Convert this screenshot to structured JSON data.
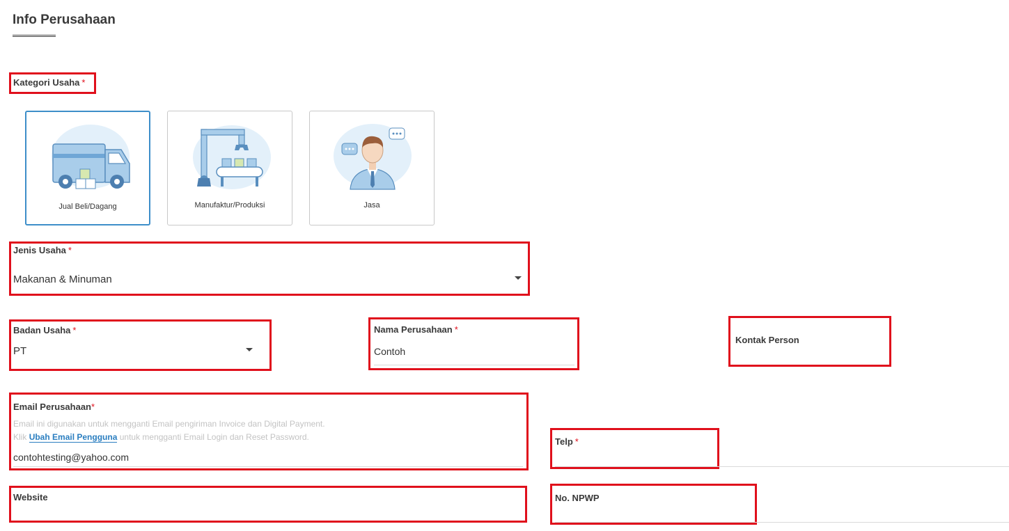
{
  "page": {
    "title": "Info Perusahaan"
  },
  "kategori": {
    "label": "Kategori Usaha",
    "required_mark": "*",
    "options": [
      {
        "label": "Jual Beli/Dagang",
        "icon": "truck-icon",
        "selected": true
      },
      {
        "label": "Manufaktur/Produksi",
        "icon": "robot-arm-conveyor-icon",
        "selected": false
      },
      {
        "label": "Jasa",
        "icon": "customer-service-person-icon",
        "selected": false
      }
    ]
  },
  "jenis_usaha": {
    "label": "Jenis Usaha",
    "required_mark": "*",
    "value": "Makanan & Minuman"
  },
  "badan_usaha": {
    "label": "Badan Usaha",
    "required_mark": "*",
    "value": "PT"
  },
  "nama_perusahaan": {
    "label": "Nama Perusahaan",
    "required_mark": "*",
    "value": "Contoh"
  },
  "kontak_person": {
    "label": "Kontak Person",
    "value": ""
  },
  "email": {
    "label": "Email Perusahaan",
    "required_mark": "*",
    "hint_line1": "Email ini digunakan untuk mengganti Email pengiriman Invoice dan Digital Payment.",
    "hint_prefix": "Klik",
    "hint_link": "Ubah Email Pengguna",
    "hint_suffix": "untuk mengganti Email Login dan Reset Password.",
    "value": "contohtesting@yahoo.com"
  },
  "telp": {
    "label": "Telp",
    "required_mark": "*",
    "value": ""
  },
  "website": {
    "label": "Website",
    "value": ""
  },
  "npwp": {
    "label": "No. NPWP",
    "value": ""
  },
  "colors": {
    "highlight": "#e0101c",
    "accent": "#3d8ec9",
    "link": "#2a7ec0",
    "icon_blue": "#a9cdea",
    "icon_bg": "#e3f0fa"
  }
}
